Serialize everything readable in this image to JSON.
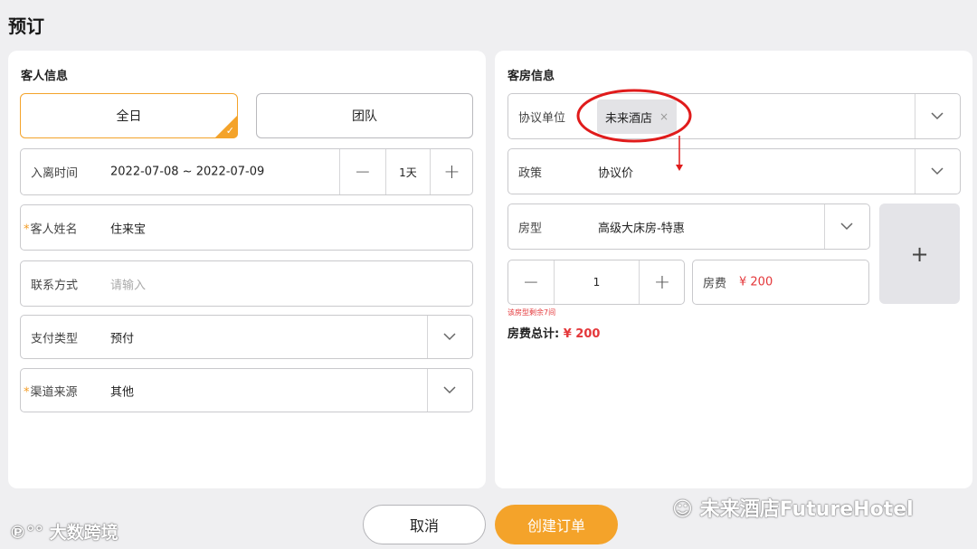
{
  "page_title": "预订",
  "guest_info": {
    "section_title": "客人信息",
    "mode_tabs": [
      {
        "label": "全日",
        "active": true
      },
      {
        "label": "团队",
        "active": false
      }
    ],
    "stay": {
      "label": "入离时间",
      "value": "2022-07-08 ~ 2022-07-09",
      "nights": "1天"
    },
    "guest_name": {
      "label": "客人姓名",
      "value": "住来宝",
      "required": true
    },
    "contact": {
      "label": "联系方式",
      "placeholder": "请输入"
    },
    "payment_type": {
      "label": "支付类型",
      "value": "预付"
    },
    "channel": {
      "label": "渠道来源",
      "value": "其他",
      "required": true
    }
  },
  "room_info": {
    "section_title": "客房信息",
    "agreement_unit": {
      "label": "协议单位",
      "tag": "未来酒店",
      "tag_close": "×"
    },
    "policy": {
      "label": "政策",
      "value": "协议价"
    },
    "room_type": {
      "label": "房型",
      "value": "高级大床房-特惠"
    },
    "quantity": "1",
    "room_fee": {
      "label": "房费",
      "value": "¥ 200"
    },
    "remaining_note": "该房型剩余7间",
    "total": {
      "label": "房费总计:",
      "value": "¥ 200"
    },
    "add_room_symbol": "+"
  },
  "actions": {
    "cancel": "取消",
    "create": "创建订单"
  },
  "watermarks": {
    "left": "大数跨境",
    "right": "未来酒店FutureHotel"
  },
  "colors": {
    "accent": "#f4a32a",
    "price": "#e4373a",
    "annotation": "#e01b1b"
  }
}
